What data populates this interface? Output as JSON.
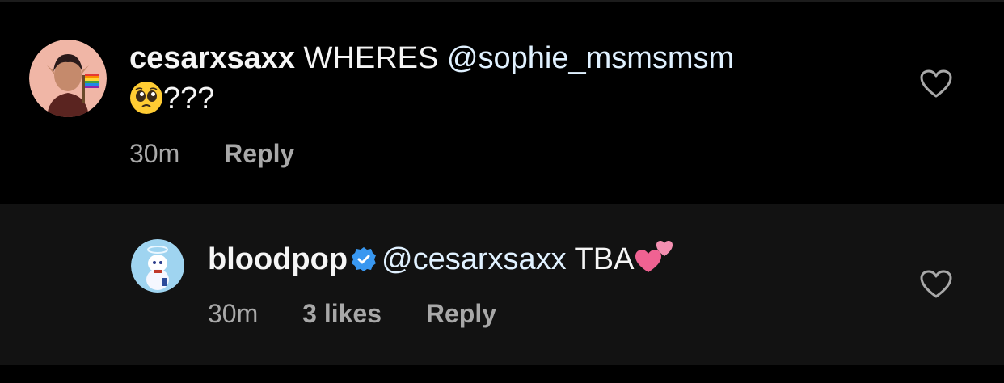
{
  "comments": [
    {
      "username": "cesarxsaxx",
      "text_prefix": " WHERES ",
      "mention": "@sophie_msmsmsm",
      "text_line2": "???",
      "time": "30m",
      "reply_label": "Reply"
    },
    {
      "username": "bloodpop",
      "verified": true,
      "mention": "@cesarxsaxx",
      "text_suffix": " TBA",
      "time": "30m",
      "likes": "3 likes",
      "reply_label": "Reply"
    }
  ],
  "colors": {
    "background": "#000000",
    "reply_background": "#121212",
    "text": "#f5f5f5",
    "muted": "#a8a8a8",
    "verified": "#3897f0"
  },
  "icons": [
    "avatar-cesarxsaxx",
    "pleading-face-emoji",
    "heart-icon",
    "avatar-bloodpop",
    "verified-badge-icon",
    "two-hearts-emoji"
  ]
}
